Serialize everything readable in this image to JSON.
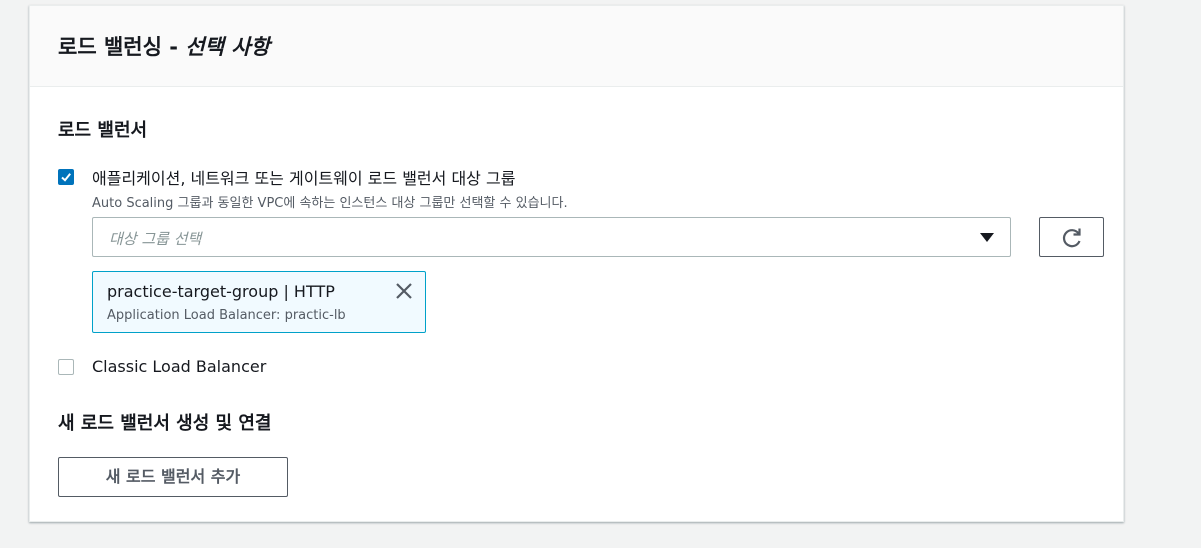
{
  "panel": {
    "title_main": "로드 밸런싱 - ",
    "title_optional": "선택 사항"
  },
  "load_balancer": {
    "section_label": "로드 밸런서",
    "option_alb": {
      "checked": true,
      "label": "애플리케이션, 네트워크 또는 게이트웨이 로드 밸런서 대상 그룹",
      "description": "Auto Scaling 그룹과 동일한 VPC에 속하는 인스턴스 대상 그룹만 선택할 수 있습니다."
    },
    "select": {
      "placeholder": "대상 그룹 선택",
      "caret_icon": "caret-down-icon"
    },
    "refresh_icon": "refresh-icon",
    "selected_token": {
      "title": "practice-target-group | HTTP",
      "description": "Application Load Balancer: practic-lb",
      "close_icon": "close-icon"
    },
    "option_classic": {
      "checked": false,
      "label": "Classic Load Balancer"
    }
  },
  "new_load_balancer": {
    "section_label": "새 로드 밸런서 생성 및 연결",
    "add_button_label": "새 로드 밸런서 추가"
  },
  "colors": {
    "accent": "#0073bb",
    "token_border": "#00a1c9",
    "token_bg": "#f1faff",
    "page_bg": "#f2f3f3"
  }
}
